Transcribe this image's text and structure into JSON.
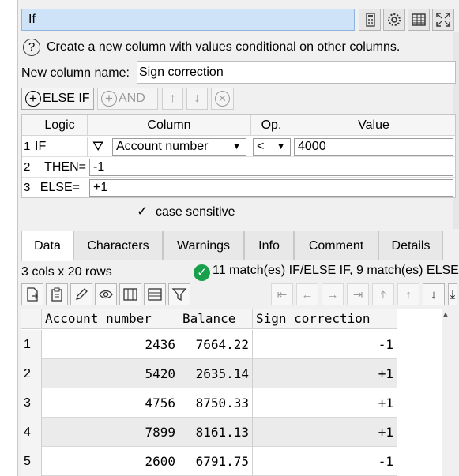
{
  "window": {
    "title": "If"
  },
  "help": {
    "text": "Create a new column with values conditional on other columns."
  },
  "new_column": {
    "label": "New column name:",
    "value": "Sign correction"
  },
  "buttons": {
    "else_if": "ELSE IF",
    "and": "AND"
  },
  "logic_table": {
    "headers": {
      "logic": "Logic",
      "column": "Column",
      "op": "Op.",
      "value": "Value"
    },
    "rows": [
      {
        "num": "1",
        "logic": "IF",
        "column": "Account number",
        "op": "<",
        "value": "4000"
      },
      {
        "num": "2",
        "logic": "THEN=",
        "value": "-1"
      },
      {
        "num": "3",
        "logic": "ELSE=",
        "value": "+1"
      }
    ]
  },
  "case_sensitive": {
    "label": "case sensitive",
    "checked": true
  },
  "tabs": [
    "Data",
    "Characters",
    "Warnings",
    "Info",
    "Comment",
    "Details"
  ],
  "status": {
    "size": "3 cols x 20 rows",
    "match": "11 match(es) IF/ELSE IF, 9 match(es) ELSE"
  },
  "grid": {
    "headers": [
      "Account number",
      "Balance",
      "Sign correction"
    ],
    "rows": [
      {
        "n": "1",
        "account": "2436",
        "balance": "7664.22",
        "sign": "-1"
      },
      {
        "n": "2",
        "account": "5420",
        "balance": "2635.14",
        "sign": "+1"
      },
      {
        "n": "3",
        "account": "4756",
        "balance": "8750.33",
        "sign": "+1"
      },
      {
        "n": "4",
        "account": "7899",
        "balance": "8161.13",
        "sign": "+1"
      },
      {
        "n": "5",
        "account": "2600",
        "balance": "6791.75",
        "sign": "-1"
      }
    ]
  },
  "colors": {
    "title_bg": "#cfe3f8",
    "ok_green": "#18a04a",
    "alt_row": "#ebebeb"
  }
}
